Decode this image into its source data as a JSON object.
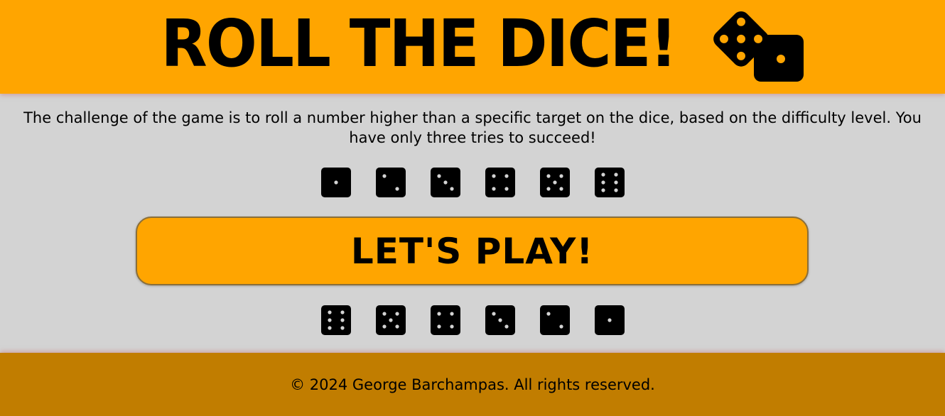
{
  "header": {
    "title": "ROLL THE DICE!",
    "icon": "dice-icon"
  },
  "intro": {
    "text": "The challenge of the game is to roll a number higher than a specific target on the dice, based on the difficulty level. You have only three tries to succeed!"
  },
  "dice_top": [
    1,
    2,
    3,
    4,
    5,
    6
  ],
  "dice_bottom": [
    6,
    5,
    4,
    3,
    2,
    1
  ],
  "play_button": {
    "label": "LET'S PLAY!"
  },
  "footer": {
    "text": "© 2024 George Barchampas. All rights reserved."
  },
  "colors": {
    "header_bg": "#ffa500",
    "body_bg": "#d3d3d3",
    "button_bg": "#ffa500",
    "footer_bg": "#c17d00"
  }
}
